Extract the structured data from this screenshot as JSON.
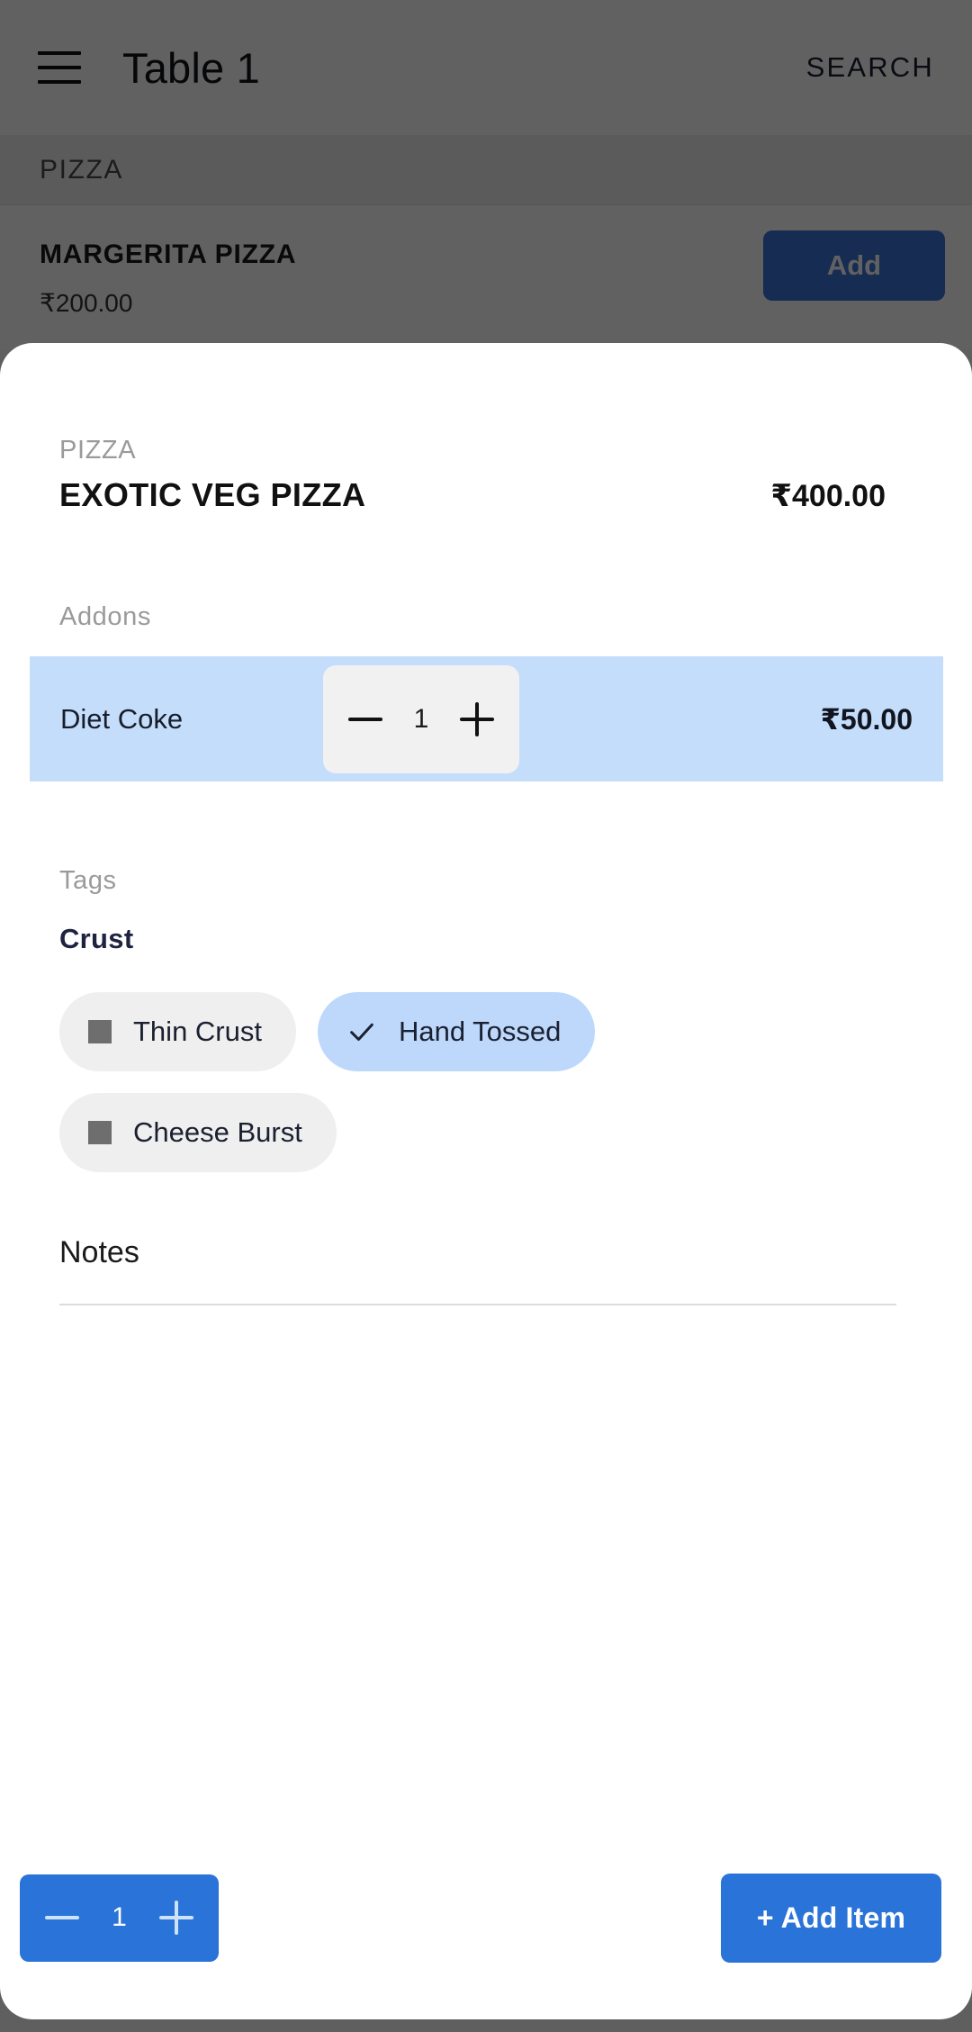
{
  "background": {
    "appbar": {
      "menu_icon": "hamburger-menu-icon",
      "title": "Table 1",
      "search_label": "SEARCH"
    },
    "section_header": "PIZZA",
    "menu_item": {
      "name": "MARGERITA PIZZA",
      "price": "₹200.00",
      "add_label": "Add"
    }
  },
  "sheet": {
    "item": {
      "category": "PIZZA",
      "name": "EXOTIC VEG PIZZA",
      "price": "₹400.00"
    },
    "addons": {
      "label": "Addons",
      "rows": [
        {
          "name": "Diet Coke",
          "quantity": "1",
          "price": "₹50.00",
          "decrement_icon": "minus-icon",
          "increment_icon": "plus-icon",
          "selected": true
        }
      ]
    },
    "tags": {
      "label": "Tags",
      "groups": [
        {
          "title": "Crust",
          "options": [
            {
              "label": "Thin Crust",
              "selected": false,
              "icon": "square-checkbox-icon"
            },
            {
              "label": "Hand Tossed",
              "selected": true,
              "icon": "check-icon"
            },
            {
              "label": "Cheese Burst",
              "selected": false,
              "icon": "square-checkbox-icon"
            }
          ]
        }
      ]
    },
    "notes": {
      "label": "Notes",
      "value": "",
      "placeholder": ""
    },
    "footer": {
      "quantity": "1",
      "decrement_icon": "minus-icon",
      "increment_icon": "plus-icon",
      "add_item_label": "+ Add Item"
    }
  },
  "colors": {
    "accent_blue": "#2a73d8",
    "addon_selected_bg": "#c4ddfb",
    "chip_selected_bg": "#bdd8fb",
    "chip_bg": "#efefef",
    "scrim": "rgba(0,0,0,0.62)"
  }
}
